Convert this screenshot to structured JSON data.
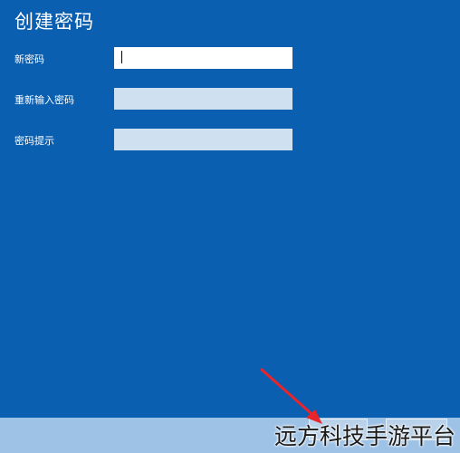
{
  "window": {
    "title": "创建密码"
  },
  "form": {
    "new_password": {
      "label": "新密码",
      "value": "",
      "placeholder": ""
    },
    "reenter_password": {
      "label": "重新输入密码",
      "value": "",
      "placeholder": ""
    },
    "password_hint": {
      "label": "密码提示",
      "value": "",
      "placeholder": ""
    }
  },
  "footer": {
    "next_label": "",
    "cancel_label": ""
  },
  "watermark": {
    "text": "远方科技手游平台"
  },
  "colors": {
    "background": "#0a5fb0",
    "footer": "#9ec2e6",
    "annotation_arrow": "#e8252b"
  }
}
